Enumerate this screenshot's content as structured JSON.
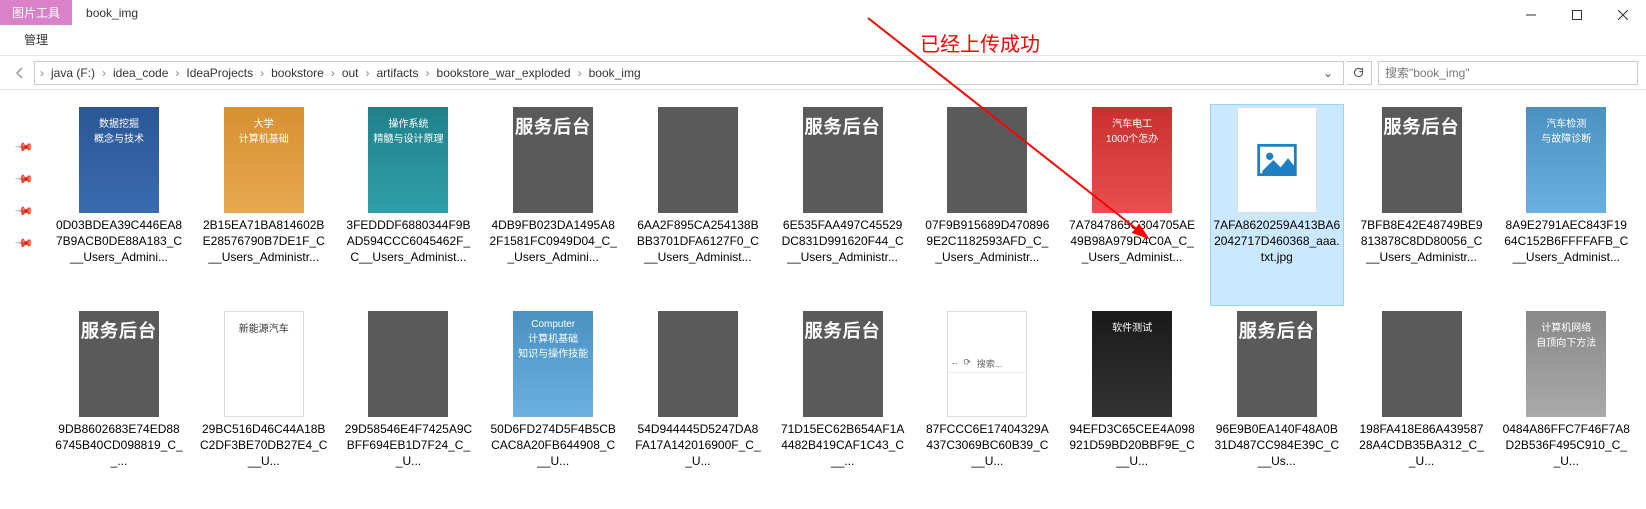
{
  "titlebar": {
    "ribbon_tab": "图片工具",
    "ribbon_subtab": "管理",
    "title": "book_img"
  },
  "breadcrumb": {
    "items": [
      "java (F:)",
      "idea_code",
      "IdeaProjects",
      "bookstore",
      "out",
      "artifacts",
      "bookstore_war_exploded",
      "book_img"
    ]
  },
  "search": {
    "placeholder": "搜索\"book_img\""
  },
  "annotation": {
    "text": "已经上传成功"
  },
  "placeholders": {
    "service": "服务后台",
    "cover_data_mining": "数据挖掘\n概念与技术",
    "cover_univ_cs": "大学\n计算机基础",
    "cover_os": "操作系统\n精髓与设计原理",
    "cover_auto_elec": "汽车电工\n1000个怎办",
    "cover_auto_diag": "汽车检测\n与故障诊断",
    "cover_new_energy": "新能源汽车",
    "cover_cs_basics": "Computer\n计算机基础\n知识与操作技能",
    "cover_sw_test": "软件测试",
    "cover_network": "计算机网络\n自顶向下方法",
    "browser_search": "搜索..."
  },
  "files": [
    {
      "name": "0D03BDEA39C446EA87B9ACB0DE88A183_C__Users_Admini...",
      "type": "cover",
      "variant": "",
      "textKey": "cover_data_mining"
    },
    {
      "name": "2B15EA71BA814602BE28576790B7DE1F_C__Users_Administr...",
      "type": "cover",
      "variant": "orange",
      "textKey": "cover_univ_cs"
    },
    {
      "name": "3FEDDDF6880344F9BAD594CCC6045462F_C__Users_Administ...",
      "type": "cover",
      "variant": "teal",
      "textKey": "cover_os"
    },
    {
      "name": "4DB9FB023DA1495A82F1581FC0949D04_C__Users_Admini...",
      "type": "dark",
      "textKey": "service"
    },
    {
      "name": "6AA2F895CA254138BBB3701DFA6127F0_C__Users_Administ...",
      "type": "dark",
      "textKey": ""
    },
    {
      "name": "6E535FAA497C45529DC831D991620F44_C__Users_Administr...",
      "type": "dark",
      "textKey": "service"
    },
    {
      "name": "07F9B915689D4708969E2C1182593AFD_C__Users_Administr...",
      "type": "dark",
      "textKey": ""
    },
    {
      "name": "7A7847865C304705AE49B98A979D4C0A_C__Users_Administ...",
      "type": "cover",
      "variant": "red",
      "textKey": "cover_auto_elec"
    },
    {
      "name": "7AFA8620259A413BA62042717D460368_aaa.txt.jpg",
      "type": "placeholder",
      "selected": true
    },
    {
      "name": "7BFB8E42E48749BE9813878C8DD80056_C__Users_Administr...",
      "type": "dark",
      "textKey": "service"
    },
    {
      "name": "8A9E2791AEC843F1964C152B6FFFFAFB_C__Users_Administ...",
      "type": "cover",
      "variant": "lightblue",
      "textKey": "cover_auto_diag"
    },
    {
      "name": "9DB8602683E74ED886745B40CD098819_C__...",
      "type": "dark",
      "textKey": "service"
    },
    {
      "name": "29BC516D46C44A18BC2DF3BE70DB27E4_C__U...",
      "type": "cover",
      "variant": "white",
      "textKey": "cover_new_energy"
    },
    {
      "name": "29D58546E4F7425A9CBFF694EB1D7F24_C__U...",
      "type": "dark",
      "textKey": ""
    },
    {
      "name": "50D6FD274D5F4B5CBCAC8A20FB644908_C__U...",
      "type": "cover",
      "variant": "lightblue",
      "textKey": "cover_cs_basics"
    },
    {
      "name": "54D944445D5247DA8FA17A142016900F_C__U...",
      "type": "dark",
      "textKey": ""
    },
    {
      "name": "71D15EC62B654AF1A4482B419CAF1C43_C__...",
      "type": "dark",
      "textKey": "service"
    },
    {
      "name": "87FCCC6E17404329A437C3069BC60B39_C__U...",
      "type": "browser"
    },
    {
      "name": "94EFD3C65CEE4A098921D59BD20BBF9E_C__U...",
      "type": "cover",
      "variant": "black",
      "textKey": "cover_sw_test"
    },
    {
      "name": "96E9B0EA140F48A0B31D487CC984E39C_C__Us...",
      "type": "dark",
      "textKey": "service"
    },
    {
      "name": "198FA418E86A43958728A4CDB35BA312_C__U...",
      "type": "dark",
      "textKey": ""
    },
    {
      "name": "0484A86FFC7F46F7A8D2B536F495C910_C__U...",
      "type": "cover",
      "variant": "gray",
      "textKey": "cover_network"
    }
  ]
}
